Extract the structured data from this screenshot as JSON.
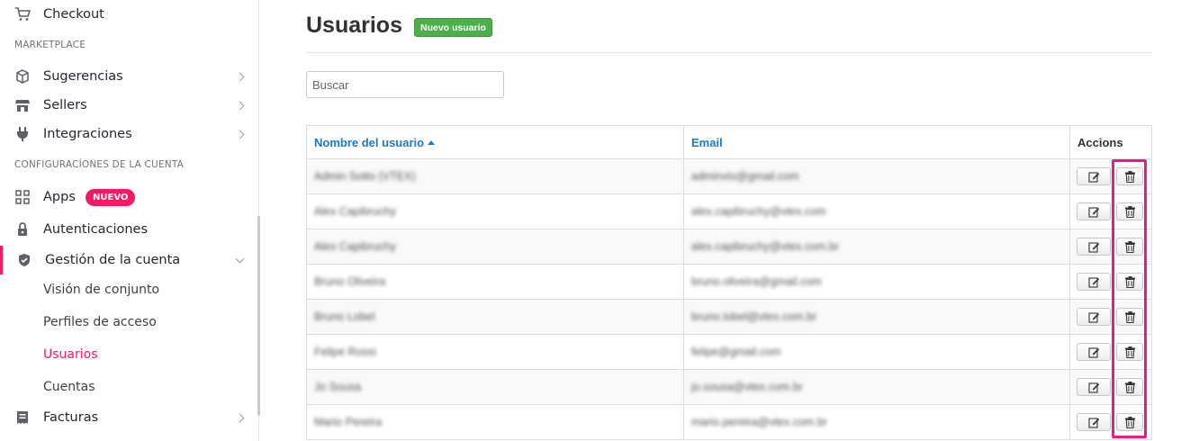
{
  "sidebar": {
    "items": [
      {
        "label": "Checkout",
        "icon": "cart-icon"
      },
      {
        "label": "Sugerencias",
        "icon": "box-icon"
      },
      {
        "label": "Sellers",
        "icon": "store-icon"
      },
      {
        "label": "Integraciones",
        "icon": "plug-icon"
      },
      {
        "label": "Apps",
        "icon": "apps-grid-icon",
        "badge": "NUEVO"
      },
      {
        "label": "Autenticaciones",
        "icon": "lock-icon"
      },
      {
        "label": "Gestión de la cuenta",
        "icon": "shield-icon"
      },
      {
        "label": "Facturas",
        "icon": "invoice-icon"
      }
    ],
    "sections": [
      "MARKETPLACE",
      "CONFIGURACÍONES DE LA CUENTA"
    ],
    "sub_items": [
      "Visión de conjunto",
      "Perfiles de acceso",
      "Usuarios",
      "Cuentas"
    ],
    "active_sub_item": "Usuarios",
    "accent_color": "#f71963"
  },
  "main": {
    "title": "Usuarios",
    "new_user_label": "Nuevo usuario",
    "search_placeholder": "Buscar",
    "table": {
      "headers": [
        "Nombre del usuario",
        "Email",
        "Accions"
      ],
      "sort_column": "Nombre del usuario",
      "sort_direction": "ascending",
      "rows": [
        {
          "name": "Admin Sotto (VTEX)",
          "email": "adminvtx@gmail.com"
        },
        {
          "name": "Alex Capibruchy",
          "email": "alex.capibruchy@vtex.com"
        },
        {
          "name": "Alex Capibruchy",
          "email": "alex.capibruchy@vtex.com.br"
        },
        {
          "name": "Bruno Oliveira",
          "email": "bruno.oliveira@gmail.com"
        },
        {
          "name": "Bruno Lobel",
          "email": "bruno.lobel@vtex.com.br"
        },
        {
          "name": "Felipe Rossi",
          "email": "felipe@gmail.com"
        },
        {
          "name": "Jo Sousa",
          "email": "jo.sousa@vtex.com.br"
        },
        {
          "name": "Mario Pereira",
          "email": "mario.pereira@vtex.com.br"
        }
      ],
      "row_actions": [
        "edit-icon",
        "trash-icon"
      ]
    },
    "highlight_color": "#ec1c7f"
  }
}
